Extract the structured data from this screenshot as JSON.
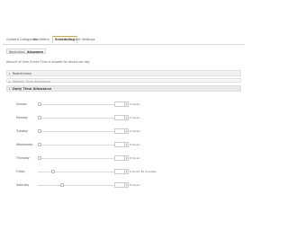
{
  "tabs": [
    {
      "label": "Content Categories"
    },
    {
      "label": "Identifiers"
    },
    {
      "label": "Scheduling"
    },
    {
      "label": "User Settings"
    }
  ],
  "active_tab": "Scheduling",
  "subtabs": [
    {
      "label": "Restriction"
    },
    {
      "label": "Allowance"
    }
  ],
  "active_subtab": "Allowance",
  "hint": "Amount of time Screen Time is allowed for device per day",
  "sections": {
    "restrictions": "Restrictions",
    "weekly": "Weekly Time Allowance",
    "daily": "Daily Time Allowance"
  },
  "days": [
    {
      "name": "Sunday",
      "value": "",
      "hours_label": "0 hours",
      "fraction": 0.0
    },
    {
      "name": "Monday",
      "value": "",
      "hours_label": "0 hours",
      "fraction": 0.0
    },
    {
      "name": "Tuesday",
      "value": "",
      "hours_label": "0 hours",
      "fraction": 0.0
    },
    {
      "name": "Wednesday",
      "value": "",
      "hours_label": "0 hours",
      "fraction": 0.0
    },
    {
      "name": "Thursday",
      "value": "",
      "hours_label": "0 hours",
      "fraction": 0.0
    },
    {
      "name": "Friday",
      "value": "",
      "hours_label": "6 hours 30 minutes",
      "fraction": 0.2
    },
    {
      "name": "Saturday",
      "value": "",
      "hours_label": "8 hours",
      "fraction": 0.33
    }
  ],
  "icons": {
    "section_collapsed": "triangle-right-icon",
    "section_expanded": "triangle-down-icon",
    "spinner": "spinner-arrows-icon"
  }
}
